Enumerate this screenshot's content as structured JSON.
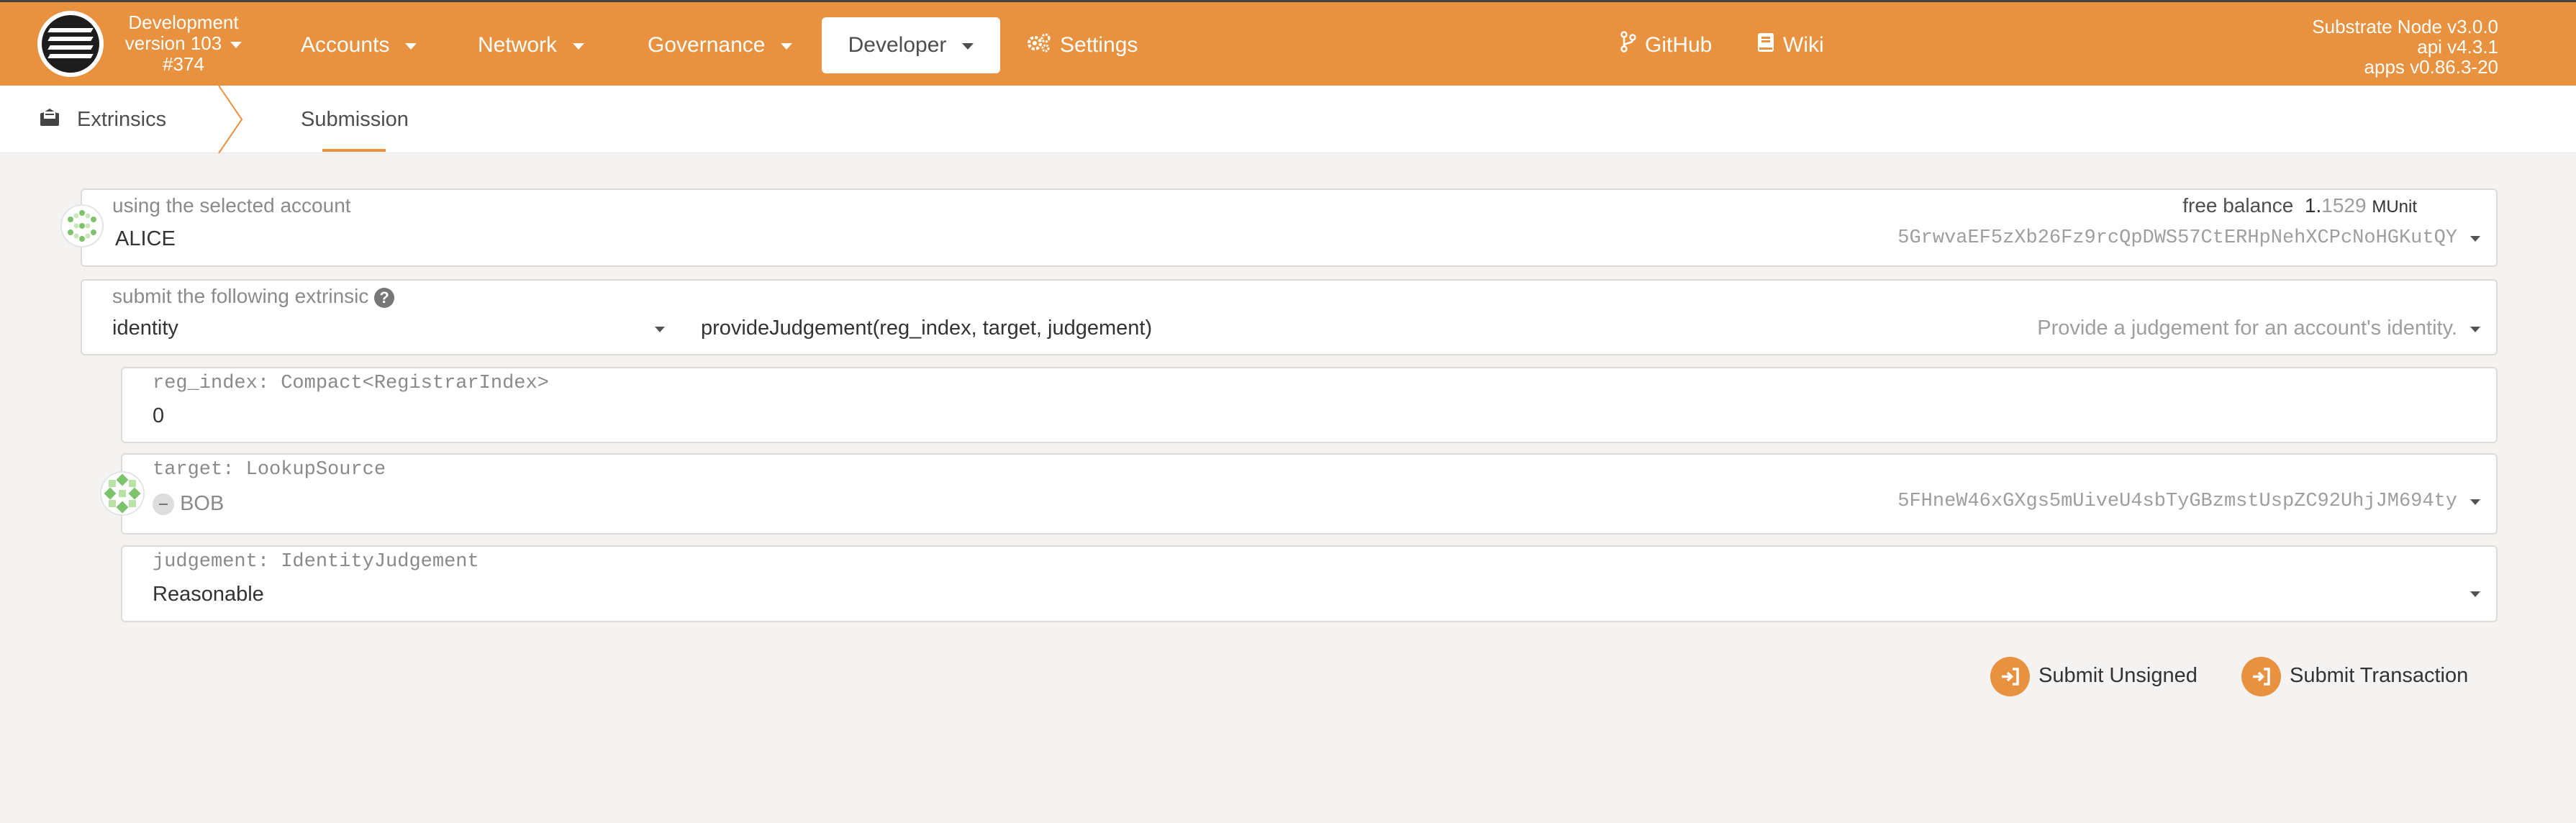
{
  "colors": {
    "accent": "#e8913f",
    "background": "#f4f3f1",
    "card": "#ffffff"
  },
  "topbar": {
    "chain": {
      "name": "Development",
      "version": "version 103",
      "block": "#374"
    },
    "nav": [
      {
        "label": "Accounts"
      },
      {
        "label": "Network"
      },
      {
        "label": "Governance"
      },
      {
        "label": "Developer"
      },
      {
        "label": "Settings",
        "icon": "gears-icon"
      },
      {
        "label": "GitHub",
        "icon": "code-branch-icon"
      },
      {
        "label": "Wiki",
        "icon": "book-icon"
      }
    ],
    "node": {
      "name": "Substrate Node v3.0.0",
      "api": "api v4.3.1",
      "apps": "apps v0.86.3-20"
    }
  },
  "tabs": {
    "home": "Extrinsics",
    "active": "Submission"
  },
  "account": {
    "label": "using the selected account",
    "name": "ALICE",
    "balance_label": "free balance",
    "balance_int": "1.",
    "balance_dec": "1529",
    "balance_unit": "MUnit",
    "address": "5GrwvaEF5zXb26Fz9rcQpDWS57CtERHpNehXCPcNoHGKutQY"
  },
  "extrinsic": {
    "label": "submit the following extrinsic",
    "section": "identity",
    "method": "provideJudgement(reg_index, target, judgement)",
    "description": "Provide a judgement for an account's identity."
  },
  "params": {
    "reg_index": {
      "label": "reg_index: Compact<RegistrarIndex>",
      "value": "0"
    },
    "target": {
      "label": "target: LookupSource",
      "name": "BOB",
      "address": "5FHneW46xGXgs5mUiveU4sbTyGBzmstUspZC92UhjJM694ty"
    },
    "judgement": {
      "label": "judgement: IdentityJudgement",
      "value": "Reasonable"
    }
  },
  "actions": {
    "unsigned": "Submit Unsigned",
    "transaction": "Submit Transaction"
  }
}
